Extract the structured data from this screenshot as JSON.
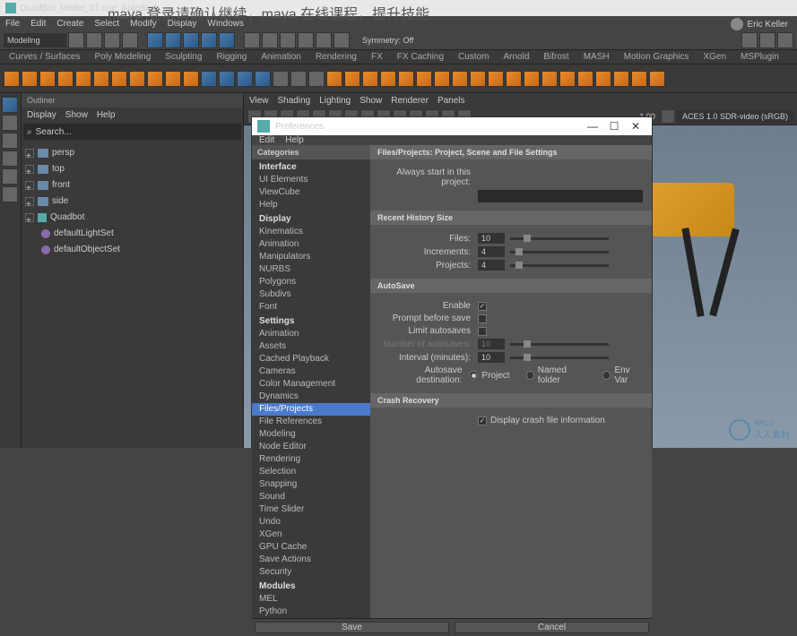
{
  "overlay_text": "maya 登录请确认继续，maya 在线课程，提升技能",
  "titlebar": {
    "filename": "QuadBot_Model_01.ma*",
    "app": "Autodesk"
  },
  "menubar": [
    "File",
    "Edit",
    "Create",
    "Select",
    "Modify",
    "Display",
    "Windows"
  ],
  "modeling_dropdown": "Modeling",
  "symmetry": "Symmetry: Off",
  "user": "Eric Keller",
  "shelf_tabs": [
    "Curves / Surfaces",
    "Poly Modeling",
    "Sculpting",
    "Rigging",
    "Animation",
    "Rendering",
    "FX",
    "FX Caching",
    "Custom",
    "Arnold",
    "Bifrost",
    "MASH",
    "Motion Graphics",
    "XGen",
    "MSPlugin"
  ],
  "outliner": {
    "title": "Outliner",
    "menu": [
      "Display",
      "Show",
      "Help"
    ],
    "search_placeholder": "Search...",
    "items": [
      {
        "type": "cam",
        "name": "persp"
      },
      {
        "type": "cam",
        "name": "top"
      },
      {
        "type": "cam",
        "name": "front"
      },
      {
        "type": "cam",
        "name": "side"
      },
      {
        "type": "cub",
        "name": "Quadbot"
      },
      {
        "type": "set",
        "name": "defaultLightSet",
        "child": true
      },
      {
        "type": "set",
        "name": "defaultObjectSet",
        "child": true
      }
    ]
  },
  "viewport": {
    "menu": [
      "View",
      "Shading",
      "Lighting",
      "Show",
      "Renderer",
      "Panels"
    ],
    "fps": "1.00",
    "colorspace": "ACES 1.0 SDR-video (sRGB)"
  },
  "prefs": {
    "title": "Preferences",
    "menu": [
      "Edit",
      "Help"
    ],
    "window_buttons": {
      "min": "—",
      "max": "☐",
      "close": "✕"
    },
    "cats_header": "Categories",
    "categories": [
      {
        "n": "Interface",
        "h": true
      },
      {
        "n": "UI Elements"
      },
      {
        "n": "ViewCube"
      },
      {
        "n": "Help"
      },
      {
        "n": "Display",
        "h": true
      },
      {
        "n": "Kinematics"
      },
      {
        "n": "Animation"
      },
      {
        "n": "Manipulators"
      },
      {
        "n": "NURBS"
      },
      {
        "n": "Polygons"
      },
      {
        "n": "Subdivs"
      },
      {
        "n": "Font"
      },
      {
        "n": "Settings",
        "h": true
      },
      {
        "n": "Animation"
      },
      {
        "n": "Assets"
      },
      {
        "n": "Cached Playback"
      },
      {
        "n": "Cameras"
      },
      {
        "n": "Color Management"
      },
      {
        "n": "Dynamics"
      },
      {
        "n": "Files/Projects",
        "sel": true
      },
      {
        "n": "File References"
      },
      {
        "n": "Modeling"
      },
      {
        "n": "Node Editor"
      },
      {
        "n": "Rendering"
      },
      {
        "n": "Selection"
      },
      {
        "n": "Snapping"
      },
      {
        "n": "Sound"
      },
      {
        "n": "Time Slider"
      },
      {
        "n": "Undo"
      },
      {
        "n": "XGen"
      },
      {
        "n": "GPU Cache"
      },
      {
        "n": "Save Actions"
      },
      {
        "n": "Security"
      },
      {
        "n": "Modules",
        "h": true
      },
      {
        "n": "MEL"
      },
      {
        "n": "Python"
      }
    ],
    "section_title": "Files/Projects: Project, Scene and File Settings",
    "always_start_label": "Always start in this project:",
    "recent_header": "Recent History Size",
    "files_label": "Files:",
    "files_val": "10",
    "increments_label": "Increments:",
    "increments_val": "4",
    "projects_label": "Projects:",
    "projects_val": "4",
    "autosave_header": "AutoSave",
    "enable_label": "Enable",
    "prompt_label": "Prompt before save",
    "limit_label": "Limit autosaves",
    "numsaves_label": "Number of autosaves:",
    "numsaves_val": "10",
    "interval_label": "Interval (minutes):",
    "interval_val": "10",
    "dest_label": "Autosave destination:",
    "dest_project": "Project",
    "dest_named": "Named folder",
    "dest_env": "Env Var",
    "crash_header": "Crash Recovery",
    "crash_display": "Display crash file information",
    "save_btn": "Save",
    "cancel_btn": "Cancel"
  },
  "watermark": {
    "text": "人人素材",
    "sub": "RRCG"
  }
}
